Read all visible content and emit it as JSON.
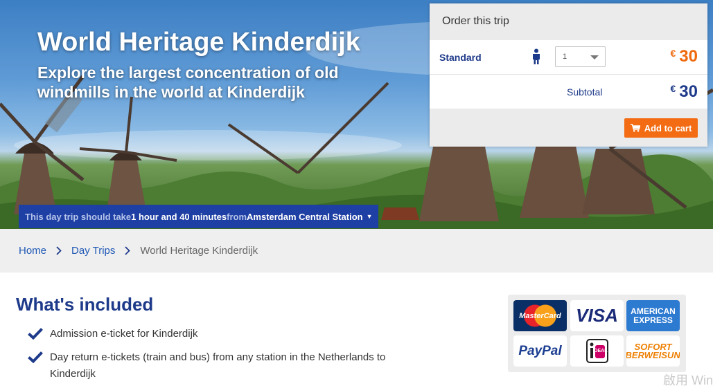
{
  "hero": {
    "title": "World Heritage Kinderdijk",
    "subtitle": "Explore the largest concentration of old windmills in the world at Kinderdijk",
    "duration_prefix": "This day trip should take",
    "duration_value": "1 hour and 40 minutes",
    "duration_from": "from",
    "duration_station": "Amsterdam Central Station",
    "duration_caret": "▼"
  },
  "order": {
    "header": "Order this trip",
    "ticket_type": "Standard",
    "ticket_icon": "person-icon",
    "quantity": "1",
    "currency": "€",
    "unit_price": "30",
    "subtotal_label": "Subtotal",
    "subtotal_value": "30",
    "add_to_cart": "Add to cart",
    "cart_icon": "cart-icon"
  },
  "breadcrumb": {
    "items": [
      "Home",
      "Day Trips"
    ],
    "current": "World Heritage Kinderdijk"
  },
  "included": {
    "title": "What's included",
    "items": [
      "Admission e-ticket for Kinderdijk",
      "Day return e-tickets (train and bus) from any station in the Netherlands to Kinderdijk"
    ]
  },
  "payments": {
    "methods": [
      "MasterCard",
      "VISA",
      "AMERICAN EXPRESS",
      "PayPal",
      "iDEAL",
      "SOFORT ÜBERWEISUNG"
    ]
  },
  "watermark": "啟用 Win",
  "colors": {
    "brand_blue": "#1e3a8a",
    "duration_bar": "#1e3fa3",
    "price_orange": "#ef6a0e",
    "cart_button": "#f36b12",
    "link": "#1e57b4"
  }
}
